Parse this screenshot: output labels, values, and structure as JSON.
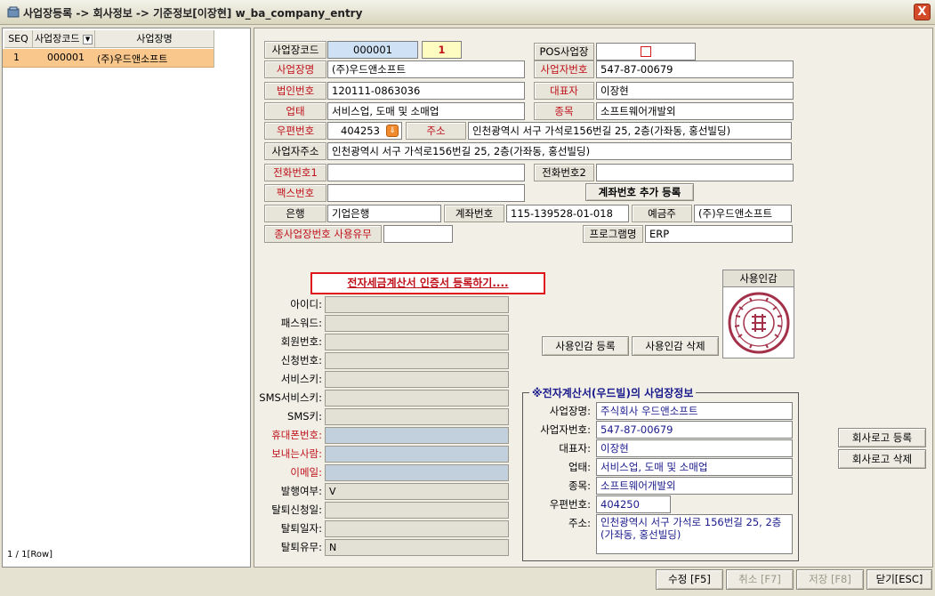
{
  "window": {
    "title": "사업장등록 -> 회사정보 -> 기준정보[이장현] w_ba_company_entry",
    "close_label": "X"
  },
  "grid": {
    "headers": [
      "SEQ",
      "사업장코드",
      "사업장명"
    ],
    "rows": [
      {
        "seq": "1",
        "code": "000001",
        "name": "(주)우드앤소프트"
      }
    ],
    "row_count": "1 / 1[Row]"
  },
  "form": {
    "biz_code_label": "사업장코드",
    "biz_code": "000001",
    "biz_seq": "1",
    "pos_label": "POS사업장",
    "biz_name_label": "사업장명",
    "biz_name": "(주)우드앤소프트",
    "biz_no_label": "사업자번호",
    "biz_no": "547-87-00679",
    "corp_no_label": "법인번호",
    "corp_no": "120111-0863036",
    "ceo_label": "대표자",
    "ceo": "이장현",
    "biz_type_label": "업태",
    "biz_type": "서비스업, 도매 및 소매업",
    "biz_item_label": "종목",
    "biz_item": "소프트웨어개발외",
    "zip_label": "우편번호",
    "zip": "404253",
    "addr_label": "주소",
    "addr": "인천광역시 서구 가석로156번길 25, 2층(가좌동, 홍선빌딩)",
    "biz_addr_label": "사업자주소",
    "biz_addr": "인천광역시 서구 가석로156번길 25, 2층(가좌동, 홍선빌딩)",
    "tel1_label": "전화번호1",
    "tel2_label": "전화번호2",
    "fax_label": "팩스번호",
    "add_account_button": "계좌번호 추가 등록",
    "bank_label": "은행",
    "bank": "기업은행",
    "account_label": "계좌번호",
    "account": "115-139528-01-018",
    "holder_label": "예금주",
    "holder": "(주)우드앤소프트",
    "subbiz_label": "종사업장번호 사용유무",
    "program_label": "프로그램명",
    "program": "ERP"
  },
  "cert": {
    "register_link": "전자세금계산서 인증서 등록하기....",
    "fields": [
      {
        "label": "아이디:",
        "value": "",
        "req": false
      },
      {
        "label": "패스워드:",
        "value": "",
        "req": false
      },
      {
        "label": "회원번호:",
        "value": "",
        "req": false
      },
      {
        "label": "신청번호:",
        "value": "",
        "req": false
      },
      {
        "label": "서비스키:",
        "value": "",
        "req": false
      },
      {
        "label": "SMS서비스키:",
        "value": "",
        "req": false
      },
      {
        "label": "SMS키:",
        "value": "",
        "req": false
      },
      {
        "label": "휴대폰번호:",
        "value": "",
        "req": true
      },
      {
        "label": "보내는사람:",
        "value": "",
        "req": true
      },
      {
        "label": "이메일:",
        "value": "",
        "req": true
      },
      {
        "label": "발행여부:",
        "value": "V",
        "req": false
      },
      {
        "label": "탈퇴신청일:",
        "value": "",
        "req": false
      },
      {
        "label": "탈퇴일자:",
        "value": "",
        "req": false
      },
      {
        "label": "탈퇴유무:",
        "value": "N",
        "req": false
      }
    ]
  },
  "seal": {
    "title": "사용인감",
    "register_button": "사용인감 등록",
    "delete_button": "사용인감 삭제"
  },
  "ebill": {
    "group_title": "※전자계산서(우드빌)의 사업장정보",
    "biz_name_label": "사업장명:",
    "biz_name": "주식회사 우드앤소프트",
    "biz_no_label": "사업자번호:",
    "biz_no": "547-87-00679",
    "ceo_label": "대표자:",
    "ceo": "이장현",
    "type_label": "업태:",
    "type": "서비스업, 도매 및 소매업",
    "item_label": "종목:",
    "item": "소프트웨어개발외",
    "zip_label": "우편번호:",
    "zip": "404250",
    "addr_label": "주소:",
    "addr": "인천광역시 서구 가석로 156번길 25, 2층(가좌동, 홍선빌딩)"
  },
  "logo": {
    "register_button": "회사로고 등록",
    "delete_button": "회사로고 삭제"
  },
  "footer": {
    "edit": "수정 [F5]",
    "cancel": "취소 [F7]",
    "save": "저장 [F8]",
    "close": "닫기[ESC]"
  },
  "colors": {
    "required_label": "#c0101a",
    "selected_row": "#f9c68b",
    "accent_blue": "#cfe1f4"
  }
}
